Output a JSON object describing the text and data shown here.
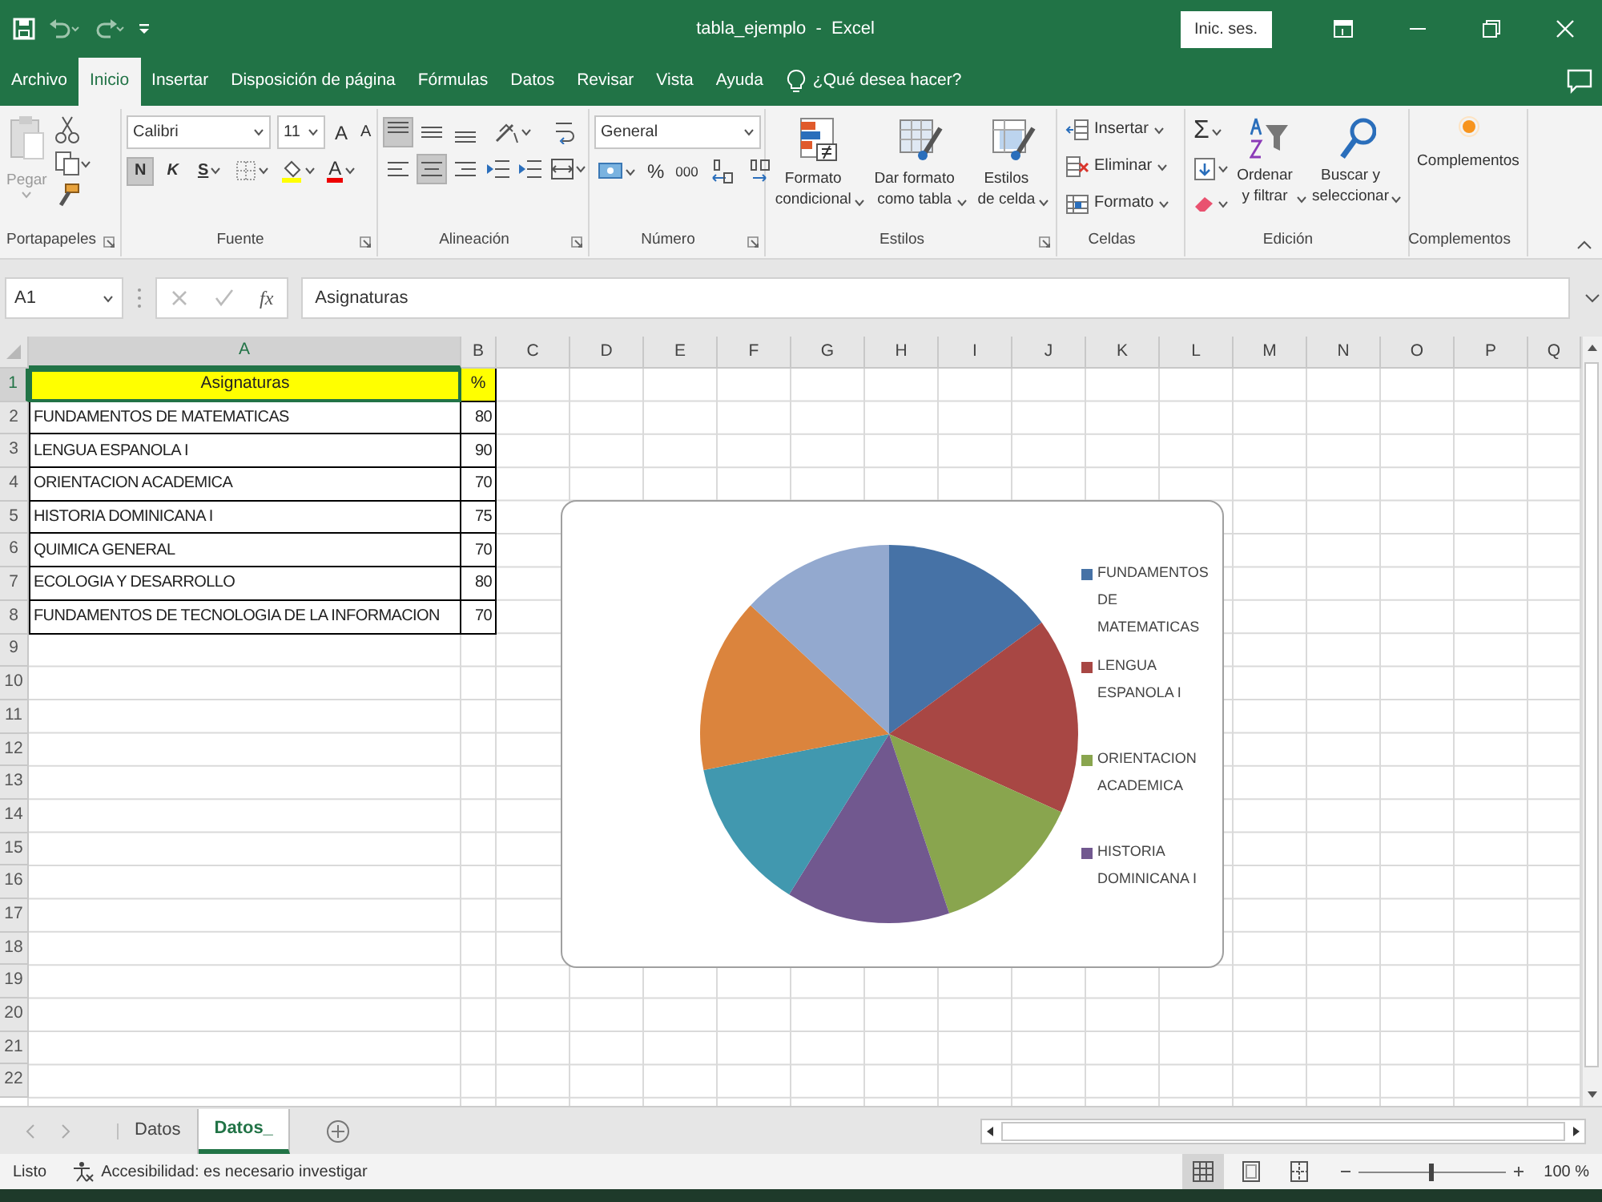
{
  "title_bar": {
    "title": "tabla_ejemplo  -  Excel",
    "sign_in": "Inic. ses."
  },
  "ribbon_tabs": [
    {
      "label": "Archivo",
      "selected": false
    },
    {
      "label": "Inicio",
      "selected": true
    },
    {
      "label": "Insertar",
      "selected": false
    },
    {
      "label": "Disposición de página",
      "selected": false
    },
    {
      "label": "Fórmulas",
      "selected": false
    },
    {
      "label": "Datos",
      "selected": false
    },
    {
      "label": "Revisar",
      "selected": false
    },
    {
      "label": "Vista",
      "selected": false
    },
    {
      "label": "Ayuda",
      "selected": false
    }
  ],
  "tell_me": "¿Qué desea hacer?",
  "clipboard": {
    "paste": "Pegar",
    "group": "Portapapeles"
  },
  "font": {
    "name": "Calibri",
    "size": "11",
    "grow": "A",
    "shrink": "A",
    "bold": "N",
    "bold_pressed": true,
    "italic": "K",
    "underline": "S",
    "font_color_letter": "A",
    "group": "Fuente"
  },
  "alignment": {
    "vertical": [
      {
        "selected": true
      },
      {
        "selected": false
      },
      {
        "selected": false
      }
    ],
    "horizontal": [
      {
        "selected": false
      },
      {
        "selected": true
      },
      {
        "selected": false
      }
    ],
    "group": "Alineación"
  },
  "number": {
    "format": "General",
    "percent": "%",
    "thousands": "000",
    "group": "Número"
  },
  "styles": {
    "buttons": [
      "Formato condicional",
      "Dar formato como tabla",
      "Estilos de celda"
    ],
    "group": "Estilos"
  },
  "cells": {
    "buttons": [
      "Insertar",
      "Eliminar",
      "Formato"
    ],
    "group": "Celdas"
  },
  "editing": {
    "sum": "Σ",
    "buttons": [
      "Ordenar y filtrar",
      "Buscar y seleccionar"
    ],
    "group": "Edición"
  },
  "addins": {
    "button": "Complementos",
    "group": "Complementos"
  },
  "formula_bar": {
    "name_box": "A1",
    "fx": "fx",
    "content": "Asignaturas"
  },
  "columns": [
    "A",
    "B",
    "C",
    "D",
    "E",
    "F",
    "G",
    "H",
    "I",
    "J",
    "K",
    "L",
    "M",
    "N",
    "O",
    "P",
    "Q"
  ],
  "row_numbers": [
    "1",
    "2",
    "3",
    "4",
    "5",
    "6",
    "7",
    "8",
    "9",
    "10",
    "11",
    "12",
    "13",
    "14",
    "15",
    "16",
    "17",
    "18",
    "19",
    "20",
    "21",
    "22"
  ],
  "table": {
    "header": [
      {
        "text": "Asignaturas",
        "selected": true
      },
      {
        "text": "%",
        "selected": false
      }
    ],
    "rows": [
      [
        "FUNDAMENTOS DE MATEMATICAS",
        "80"
      ],
      [
        "LENGUA ESPANOLA I",
        "90"
      ],
      [
        "ORIENTACION ACADEMICA",
        "70"
      ],
      [
        "HISTORIA DOMINICANA I",
        "75"
      ],
      [
        "QUIMICA GENERAL",
        "70"
      ],
      [
        "ECOLOGIA Y DESARROLLO",
        "80"
      ],
      [
        "FUNDAMENTOS DE TECNOLOGIA DE LA INFORMACION",
        "70"
      ]
    ]
  },
  "chart": {
    "legend": [
      "FUNDAMENTOS DE MATEMATICAS",
      "LENGUA ESPANOLA I",
      "ORIENTACION ACADEMICA",
      "HISTORIA DOMINICANA I"
    ],
    "chart_data": {
      "type": "pie",
      "series": [
        {
          "values": [
            14.95,
            16.82,
            13.08,
            14.02,
            13.08,
            14.96,
            13.09
          ]
        }
      ]
    }
  },
  "sheet_tabs": [
    {
      "label": "Datos",
      "selected": false
    },
    {
      "label": "Datos_",
      "selected": true
    }
  ],
  "status_bar": {
    "mode": "Listo",
    "accessibility": "Accesibilidad: es necesario investigar",
    "views": [
      {
        "selected": true
      },
      {
        "selected": false
      },
      {
        "selected": false
      }
    ],
    "zoom_slider": {
      "level": 0.5
    },
    "zoom": "100 %"
  }
}
